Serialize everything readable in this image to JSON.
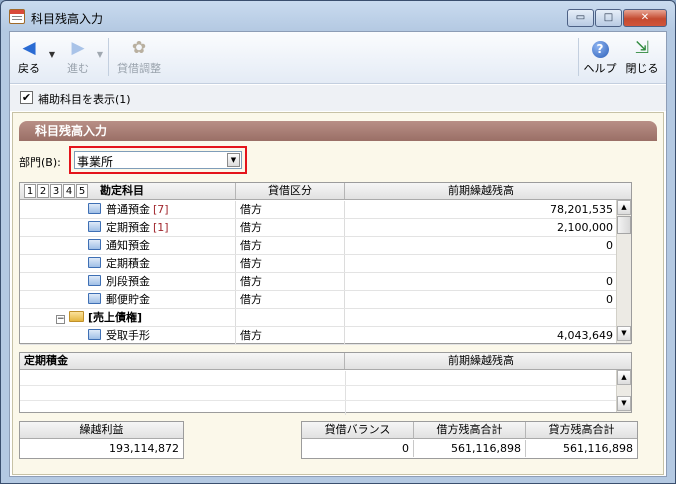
{
  "window": {
    "title": "科目残高入力",
    "controls": {
      "minimize": "▭",
      "maximize": "□",
      "close": "✕"
    }
  },
  "toolbar": {
    "back_label": "戻る",
    "forward_label": "進む",
    "adjust_label": "貸借調整",
    "help_label": "ヘルプ",
    "close_label": "閉じる",
    "icons": {
      "back": "left-arrow",
      "forward": "right-arrow",
      "adjust": "coins",
      "help": "question",
      "close": "exit-door"
    },
    "dropdown_glyph": "▼",
    "back_glyph": "◀",
    "forward_glyph": "▶",
    "adjust_glyph": "✿",
    "help_glyph": "?",
    "close_glyph": "⇲"
  },
  "options": {
    "show_sub_accounts_label": "補助科目を表示(1)",
    "show_sub_accounts_checked": true,
    "check_glyph": "✔"
  },
  "section": {
    "title": "科目残高入力"
  },
  "department": {
    "label": "部門(B):",
    "value": "事業所",
    "arrow_glyph": "▼"
  },
  "main_grid": {
    "levels": [
      "1",
      "2",
      "3",
      "4",
      "5"
    ],
    "columns": {
      "account": "勘定科目",
      "debit_credit": "貸借区分",
      "prior_balance": "前期繰越残高"
    },
    "rows": [
      {
        "name": "普通預金",
        "sub": "[7]",
        "type": "借方",
        "balance": "78,201,535",
        "kind": "account"
      },
      {
        "name": "定期預金",
        "sub": "[1]",
        "type": "借方",
        "balance": "2,100,000",
        "kind": "account"
      },
      {
        "name": "通知預金",
        "sub": "",
        "type": "借方",
        "balance": "0",
        "kind": "account"
      },
      {
        "name": "定期積金",
        "sub": "",
        "type": "借方",
        "balance": "",
        "kind": "account"
      },
      {
        "name": "別段預金",
        "sub": "",
        "type": "借方",
        "balance": "0",
        "kind": "account"
      },
      {
        "name": "郵便貯金",
        "sub": "",
        "type": "借方",
        "balance": "0",
        "kind": "account"
      },
      {
        "name": "[売上債権]",
        "sub": "",
        "type": "",
        "balance": "",
        "kind": "group",
        "toggle": "−"
      },
      {
        "name": "受取手形",
        "sub": "",
        "type": "借方",
        "balance": "4,043,649",
        "kind": "account"
      }
    ],
    "scroll_up": "▲",
    "scroll_down": "▼"
  },
  "sub_grid": {
    "columns": {
      "account": "定期積金",
      "prior_balance": "前期繰越残高"
    }
  },
  "totals": {
    "retained_earnings_label": "繰越利益",
    "retained_earnings_value": "193,114,872",
    "balance_label": "貸借バランス",
    "balance_value": "0",
    "debit_total_label": "借方残高合計",
    "debit_total_value": "561,116,898",
    "credit_total_label": "貸方残高合計",
    "credit_total_value": "561,116,898"
  }
}
